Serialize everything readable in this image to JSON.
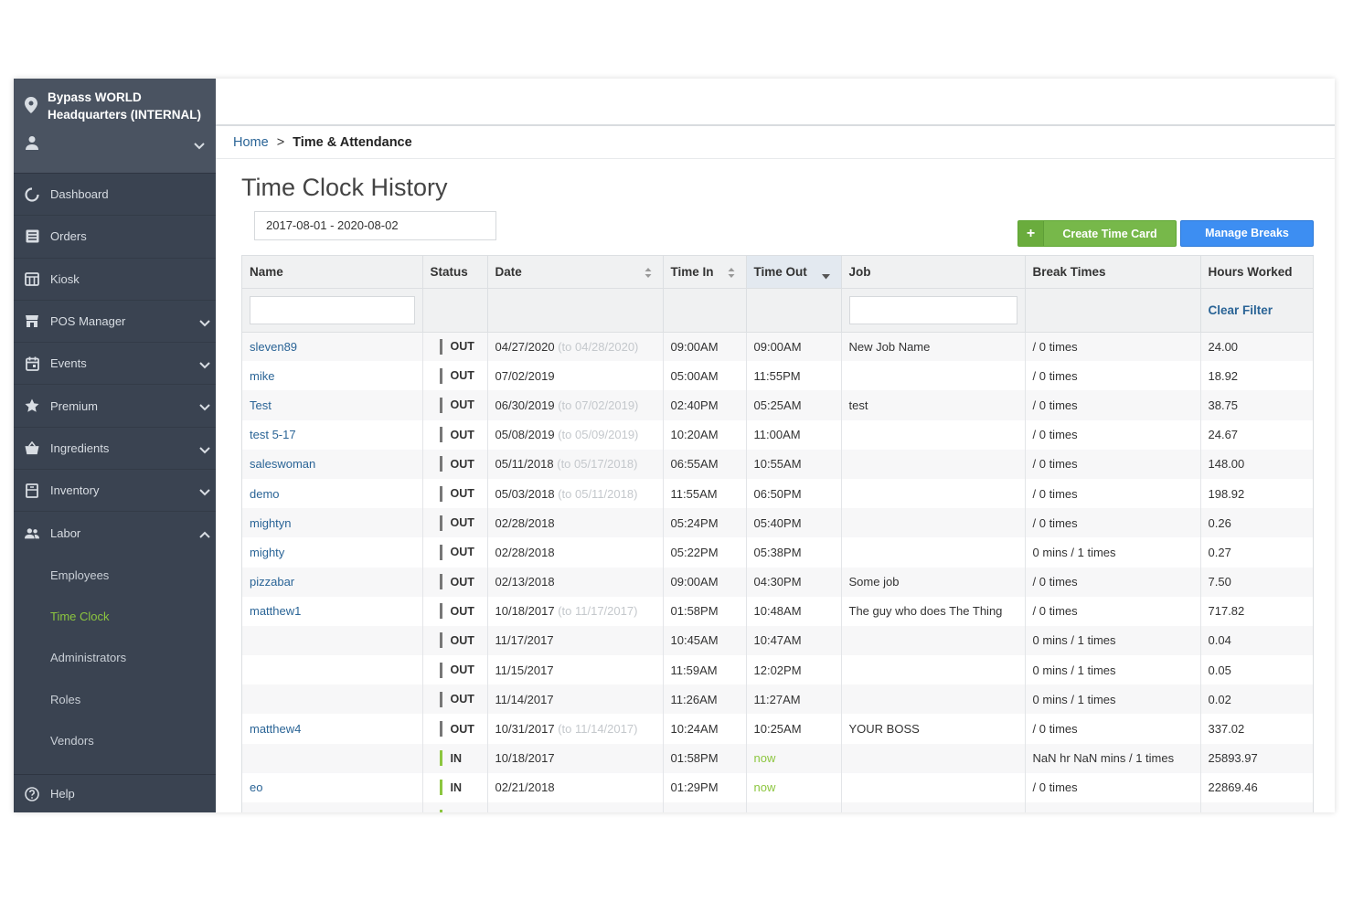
{
  "sidebar": {
    "location": "Bypass WORLD Headquarters (INTERNAL)",
    "items": [
      {
        "label": "Dashboard",
        "icon": "dashboard-icon"
      },
      {
        "label": "Orders",
        "icon": "orders-icon"
      },
      {
        "label": "Kiosk",
        "icon": "kiosk-icon"
      },
      {
        "label": "POS Manager",
        "icon": "pos-icon"
      },
      {
        "label": "Events",
        "icon": "calendar-icon"
      },
      {
        "label": "Premium",
        "icon": "star-icon"
      },
      {
        "label": "Ingredients",
        "icon": "basket-icon"
      },
      {
        "label": "Inventory",
        "icon": "inventory-icon"
      },
      {
        "label": "Labor",
        "icon": "people-icon"
      }
    ],
    "labor_sub": [
      "Employees",
      "Time Clock",
      "Administrators",
      "Roles",
      "Vendors"
    ],
    "active_sub": "Time Clock",
    "help": "Help"
  },
  "breadcrumb": {
    "home": "Home",
    "separator": ">",
    "current": "Time & Attendance"
  },
  "page": {
    "title": "Time Clock History",
    "date_range": "2017-08-01 - 2020-08-02",
    "create_button": "Create Time Card",
    "create_plus": "+",
    "breaks_button": "Manage Breaks"
  },
  "table": {
    "columns": [
      "Name",
      "Status",
      "Date",
      "Time In",
      "Time Out",
      "Job",
      "Break Times",
      "Hours Worked"
    ],
    "clear_filter": "Clear Filter",
    "rows": [
      {
        "name": "sleven89",
        "status": "OUT",
        "date": "04/27/2020",
        "date_to": "(to 04/28/2020)",
        "time_in": "09:00AM",
        "time_out": "09:00AM",
        "job": "New Job Name",
        "breaks": "/ 0 times",
        "hours": "24.00"
      },
      {
        "name": "mike",
        "status": "OUT",
        "date": "07/02/2019",
        "date_to": "",
        "time_in": "05:00AM",
        "time_out": "11:55PM",
        "job": "",
        "breaks": "/ 0 times",
        "hours": "18.92"
      },
      {
        "name": "Test",
        "status": "OUT",
        "date": "06/30/2019",
        "date_to": "(to 07/02/2019)",
        "time_in": "02:40PM",
        "time_out": "05:25AM",
        "job": "test",
        "breaks": "/ 0 times",
        "hours": "38.75"
      },
      {
        "name": "test 5-17",
        "status": "OUT",
        "date": "05/08/2019",
        "date_to": "(to 05/09/2019)",
        "time_in": "10:20AM",
        "time_out": "11:00AM",
        "job": "",
        "breaks": "/ 0 times",
        "hours": "24.67"
      },
      {
        "name": "saleswoman",
        "status": "OUT",
        "date": "05/11/2018",
        "date_to": "(to 05/17/2018)",
        "time_in": "06:55AM",
        "time_out": "10:55AM",
        "job": "",
        "breaks": "/ 0 times",
        "hours": "148.00"
      },
      {
        "name": "demo",
        "status": "OUT",
        "date": "05/03/2018",
        "date_to": "(to 05/11/2018)",
        "time_in": "11:55AM",
        "time_out": "06:50PM",
        "job": "",
        "breaks": "/ 0 times",
        "hours": "198.92"
      },
      {
        "name": "mightyn",
        "status": "OUT",
        "date": "02/28/2018",
        "date_to": "",
        "time_in": "05:24PM",
        "time_out": "05:40PM",
        "job": "",
        "breaks": "/ 0 times",
        "hours": "0.26"
      },
      {
        "name": "mighty",
        "status": "OUT",
        "date": "02/28/2018",
        "date_to": "",
        "time_in": "05:22PM",
        "time_out": "05:38PM",
        "job": "",
        "breaks": "0 mins / 1 times",
        "hours": "0.27"
      },
      {
        "name": "pizzabar",
        "status": "OUT",
        "date": "02/13/2018",
        "date_to": "",
        "time_in": "09:00AM",
        "time_out": "04:30PM",
        "job": "Some job",
        "breaks": "/ 0 times",
        "hours": "7.50"
      },
      {
        "name": "matthew1",
        "status": "OUT",
        "date": "10/18/2017",
        "date_to": "(to 11/17/2017)",
        "time_in": "01:58PM",
        "time_out": "10:48AM",
        "job": "The guy who does The Thing",
        "breaks": "/ 0 times",
        "hours": "717.82"
      },
      {
        "name": "",
        "status": "OUT",
        "date": "11/17/2017",
        "date_to": "",
        "time_in": "10:45AM",
        "time_out": "10:47AM",
        "job": "",
        "breaks": "0 mins / 1 times",
        "hours": "0.04"
      },
      {
        "name": "",
        "status": "OUT",
        "date": "11/15/2017",
        "date_to": "",
        "time_in": "11:59AM",
        "time_out": "12:02PM",
        "job": "",
        "breaks": "0 mins / 1 times",
        "hours": "0.05"
      },
      {
        "name": "",
        "status": "OUT",
        "date": "11/14/2017",
        "date_to": "",
        "time_in": "11:26AM",
        "time_out": "11:27AM",
        "job": "",
        "breaks": "0 mins / 1 times",
        "hours": "0.02"
      },
      {
        "name": "matthew4",
        "status": "OUT",
        "date": "10/31/2017",
        "date_to": "(to 11/14/2017)",
        "time_in": "10:24AM",
        "time_out": "10:25AM",
        "job": "YOUR BOSS",
        "breaks": "/ 0 times",
        "hours": "337.02"
      },
      {
        "name": "",
        "status": "IN",
        "date": "10/18/2017",
        "date_to": "",
        "time_in": "01:58PM",
        "time_out": "now",
        "job": "",
        "breaks": "NaN hr NaN mins / 1 times",
        "hours": "25893.97"
      },
      {
        "name": "eo",
        "status": "IN",
        "date": "02/21/2018",
        "date_to": "",
        "time_in": "01:29PM",
        "time_out": "now",
        "job": "",
        "breaks": "/ 0 times",
        "hours": "22869.46"
      },
      {
        "name": "",
        "status": "IN",
        "date": "",
        "date_to": "",
        "time_in": "",
        "time_out": "",
        "job": "",
        "breaks": "",
        "hours": ""
      }
    ]
  },
  "colors": {
    "sidebar": "#3a4351",
    "accent_green": "#8cc63f",
    "link": "#2a6496",
    "create_btn": "#77b84a",
    "breaks_btn": "#3d8ef2"
  }
}
